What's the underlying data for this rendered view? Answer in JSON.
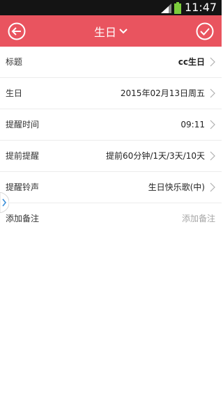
{
  "status_bar": {
    "time": "11:47",
    "icons": [
      "signal-icon",
      "battery-icon"
    ]
  },
  "header": {
    "title": "生日",
    "back_icon": "back-arrow-icon",
    "confirm_icon": "check-icon",
    "dropdown_icon": "chevron-down-icon",
    "color": "#e9545f"
  },
  "form": {
    "rows": [
      {
        "label": "标题",
        "value": "cc生日"
      },
      {
        "label": "生日",
        "value": "2015年02月13日周五"
      },
      {
        "label": "提醒时间",
        "value": "09:11"
      },
      {
        "label": "提前提醒",
        "value": "提前60分钟/1天/3天/10天"
      },
      {
        "label": "提醒铃声",
        "value": "生日快乐歌(中)"
      },
      {
        "label": "添加备注",
        "placeholder": "添加备注"
      }
    ]
  },
  "side_tab_icon": "chevron-right-icon"
}
